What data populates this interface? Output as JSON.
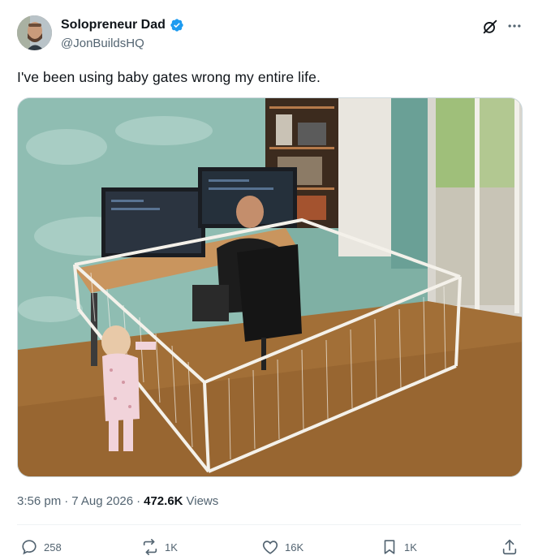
{
  "author": {
    "display_name": "Solopreneur Dad",
    "handle": "@JonBuildsHQ",
    "verified": true
  },
  "tweet": {
    "text": "I've been using baby gates wrong my entire life.",
    "time": "3:56 pm",
    "date": "7 Aug 2026",
    "views_count": "472.6K",
    "views_label": "Views"
  },
  "actions": {
    "replies": "258",
    "reposts": "1K",
    "likes": "16K",
    "bookmarks": "1K"
  },
  "icons": [
    "grok-icon",
    "more-icon",
    "reply-icon",
    "repost-icon",
    "like-icon",
    "bookmark-icon",
    "share-icon",
    "verified-badge-icon"
  ],
  "colors": {
    "verified": "#1d9bf0",
    "secondary_text": "#536471",
    "primary_text": "#0f1419"
  }
}
